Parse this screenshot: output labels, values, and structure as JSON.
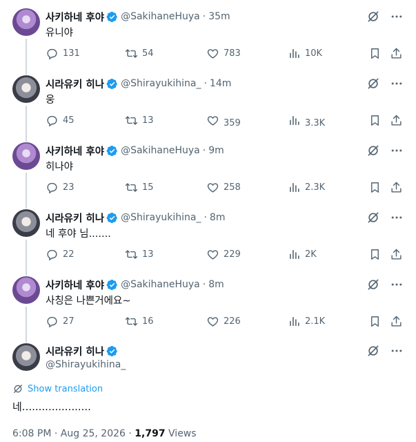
{
  "colors": {
    "accent": "#1d9bf0",
    "muted": "#536471",
    "text": "#0f1419",
    "line": "#cfd9de"
  },
  "replies": [
    {
      "avatar": "avatar-sakihane-huya",
      "name": "사키하네 후야",
      "handle": "@SakihaneHuya",
      "time": "35m",
      "text": "유니야",
      "stats": {
        "replies": "131",
        "reposts": "54",
        "likes": "783",
        "views": "10K"
      }
    },
    {
      "avatar": "avatar-shirayukihina",
      "name": "시라유키 히나",
      "handle": "@Shirayukihina_",
      "time": "14m",
      "text": "웅",
      "stats": {
        "replies": "45",
        "reposts": "13",
        "likes": "359",
        "views": "3.3K"
      }
    },
    {
      "avatar": "avatar-sakihane-huya",
      "name": "사키하네 후야",
      "handle": "@SakihaneHuya",
      "time": "9m",
      "text": "히나야",
      "stats": {
        "replies": "23",
        "reposts": "15",
        "likes": "258",
        "views": "2.3K"
      }
    },
    {
      "avatar": "avatar-shirayukihina",
      "name": "시라유키 히나",
      "handle": "@Shirayukihina_",
      "time": "8m",
      "text": "네 후야 님.......",
      "stats": {
        "replies": "22",
        "reposts": "13",
        "likes": "229",
        "views": "2K"
      }
    },
    {
      "avatar": "avatar-sakihane-huya",
      "name": "사키하네 후야",
      "handle": "@SakihaneHuya",
      "time": "8m",
      "text": "사칭은 나쁜거에요~",
      "stats": {
        "replies": "27",
        "reposts": "16",
        "likes": "226",
        "views": "2.1K"
      }
    }
  ],
  "main_tweet": {
    "name": "시라유키 히나",
    "handle": "@Shirayukihina_",
    "translate_label": "Show translation",
    "text": "네.....................",
    "time": "6:08 PM",
    "date": "Aug 25, 2026",
    "views_count": "1,797",
    "views_label": "Views",
    "separator": "·"
  }
}
